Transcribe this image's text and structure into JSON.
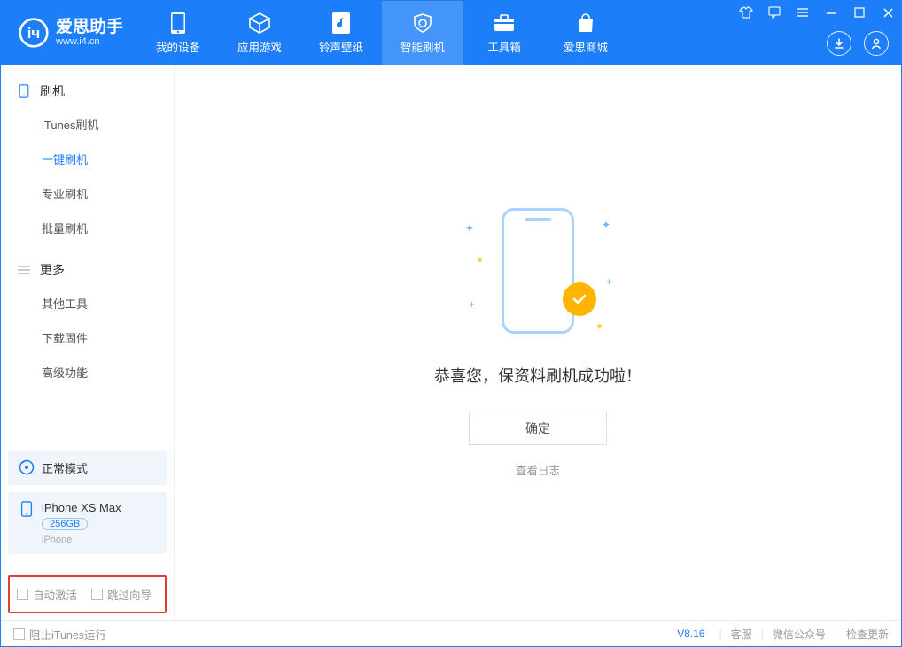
{
  "app": {
    "title": "爱思助手",
    "subtitle": "www.i4.cn"
  },
  "tabs": [
    {
      "label": "我的设备"
    },
    {
      "label": "应用游戏"
    },
    {
      "label": "铃声壁纸"
    },
    {
      "label": "智能刷机"
    },
    {
      "label": "工具箱"
    },
    {
      "label": "爱思商城"
    }
  ],
  "sidebar": {
    "group1": {
      "title": "刷机",
      "items": [
        "iTunes刷机",
        "一键刷机",
        "专业刷机",
        "批量刷机"
      ]
    },
    "group2": {
      "title": "更多",
      "items": [
        "其他工具",
        "下载固件",
        "高级功能"
      ]
    }
  },
  "device": {
    "mode": "正常模式",
    "name": "iPhone XS Max",
    "capacity": "256GB",
    "type": "iPhone"
  },
  "options": {
    "autoActivate": "自动激活",
    "skipGuide": "跳过向导"
  },
  "main": {
    "successText": "恭喜您，保资料刷机成功啦！",
    "okButton": "确定",
    "viewLog": "查看日志"
  },
  "status": {
    "blockItunes": "阻止iTunes运行",
    "version": "V8.16",
    "links": [
      "客服",
      "微信公众号",
      "检查更新"
    ]
  }
}
